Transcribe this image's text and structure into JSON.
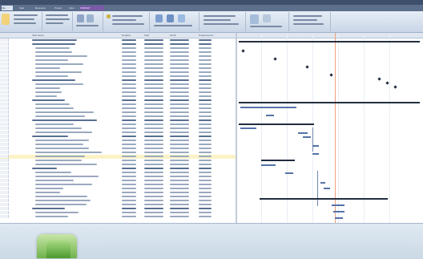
{
  "app": {
    "ribbon_tabs": [
      "File",
      "Task",
      "Resource",
      "Project",
      "View",
      "FORMAT"
    ],
    "active_tab": "FORMAT",
    "context_tab": "FORMAT",
    "accent_color": "#7a5aa8",
    "gantt_bar_color": "#5573a8",
    "summary_bar_color": "#222d40",
    "today_line_color": "#f2a07a"
  },
  "table": {
    "columns": [
      "",
      "Task Name",
      "Duration",
      "Start",
      "Finish",
      "Predecessors"
    ],
    "rows": [
      {
        "id": "0",
        "name": "Wilson Construction",
        "type": "summary"
      },
      {
        "id": "1",
        "name": "Project Milestones",
        "type": "summary"
      },
      {
        "id": "2",
        "name": "Contract Award",
        "type": "normal"
      },
      {
        "id": "3",
        "name": "Kick-off Meeting",
        "type": "normal"
      },
      {
        "id": "4",
        "name": "Functional Design Approved",
        "type": "normal"
      },
      {
        "id": "5",
        "name": "Detail Design",
        "type": "normal"
      },
      {
        "id": "6",
        "name": "Final Mounting Complete",
        "type": "normal"
      },
      {
        "id": "7",
        "name": "SAT Test",
        "type": "normal"
      },
      {
        "id": "8",
        "name": "Documentation Complete",
        "type": "normal"
      },
      {
        "id": "9",
        "name": "Commissioning",
        "type": "normal"
      },
      {
        "id": "10",
        "name": "Project Management",
        "type": "summary"
      },
      {
        "id": "11",
        "name": "Project Management Work",
        "type": "normal"
      },
      {
        "id": "12",
        "name": "Meetings",
        "type": "normal"
      },
      {
        "id": "13",
        "name": "Reporting",
        "type": "normal"
      },
      {
        "id": "14",
        "name": "Travel",
        "type": "normal"
      },
      {
        "id": "15",
        "name": "Procurement",
        "type": "summary"
      },
      {
        "id": "16",
        "name": "Order Hardware",
        "type": "normal"
      },
      {
        "id": "17",
        "name": "Order Instruments",
        "type": "normal"
      },
      {
        "id": "18",
        "name": "Administration Project Meeting",
        "type": "normal"
      },
      {
        "id": "19",
        "name": "Engineering Deliverables",
        "type": "normal"
      },
      {
        "id": "20",
        "name": "Process Definition Documentation",
        "type": "summary"
      },
      {
        "id": "21",
        "name": "Overall Narrative",
        "type": "normal"
      },
      {
        "id": "22",
        "name": "Unit Operation Details",
        "type": "normal"
      },
      {
        "id": "23",
        "name": "Standardization Phase Meeting",
        "type": "normal"
      },
      {
        "id": "24",
        "name": "Specification",
        "type": "summary"
      },
      {
        "id": "25",
        "name": "Control System Requirements",
        "type": "normal"
      },
      {
        "id": "26",
        "name": "Project Management Plan",
        "type": "normal"
      },
      {
        "id": "27",
        "name": "System Configuration Design",
        "type": "normal"
      },
      {
        "id": "28",
        "name": "Hardware and Software Specification",
        "type": "normal"
      },
      {
        "id": "29",
        "name": "Review of Specifications",
        "type": "normal"
      },
      {
        "id": "30",
        "name": "Specification Revision",
        "type": "normal"
      },
      {
        "id": "31",
        "name": "Specification Phase Gate Meeting",
        "type": "normal"
      },
      {
        "id": "32",
        "name": "Design",
        "type": "summary"
      },
      {
        "id": "33",
        "name": "Data Collection",
        "type": "normal"
      },
      {
        "id": "34",
        "name": "Data Review of Technical Sections",
        "type": "normal"
      },
      {
        "id": "35",
        "name": "Type Descriptions",
        "type": "normal"
      },
      {
        "id": "36",
        "name": "Detailed Design Specification",
        "type": "normal"
      },
      {
        "id": "37",
        "name": "HMI Design",
        "type": "normal"
      },
      {
        "id": "38",
        "name": "I/O List",
        "type": "normal"
      },
      {
        "id": "39",
        "name": "Work Draft Test Procedures",
        "type": "normal"
      },
      {
        "id": "40",
        "name": "Review of Technical Sections",
        "type": "normal"
      },
      {
        "id": "41",
        "name": "Design Phase Gate Meeting",
        "type": "normal"
      },
      {
        "id": "42",
        "name": "Engineering",
        "type": "summary"
      },
      {
        "id": "43",
        "name": "Engineering Work Off",
        "type": "normal"
      },
      {
        "id": "44",
        "name": "Configuration",
        "type": "normal"
      }
    ],
    "selected_row": 29
  }
}
